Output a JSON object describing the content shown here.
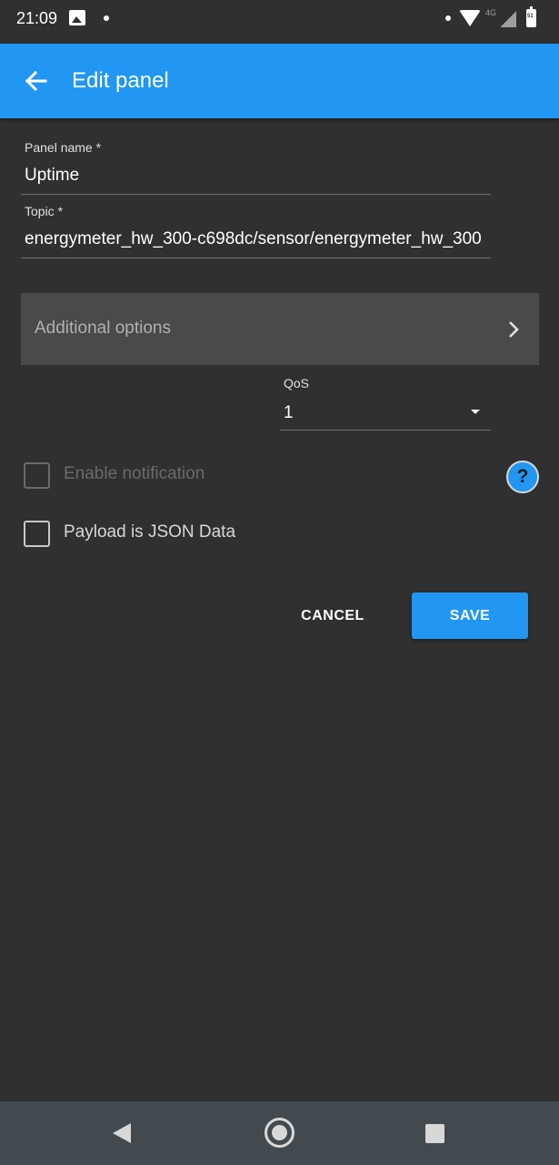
{
  "status_bar": {
    "time": "21:09",
    "network": "4G",
    "battery": "51"
  },
  "app_bar": {
    "title": "Edit panel",
    "back_icon": "arrow-back-icon"
  },
  "form": {
    "panel_name": {
      "label": "Panel name *",
      "value": "Uptime"
    },
    "topic": {
      "label": "Topic *",
      "value": "energymeter_hw_300-c698dc/sensor/energymeter_hw_300"
    },
    "additional_options": {
      "label": "Additional options"
    },
    "qos": {
      "label": "QoS",
      "value": "1"
    },
    "enable_notification": {
      "label": "Enable notification",
      "checked": false,
      "disabled": true
    },
    "payload_json": {
      "label": "Payload is JSON Data",
      "checked": false
    },
    "help_icon": "?"
  },
  "actions": {
    "cancel_label": "CANCEL",
    "save_label": "SAVE"
  },
  "colors": {
    "primary": "#2196f3",
    "background": "#303030",
    "panel": "#4a4a4a"
  }
}
